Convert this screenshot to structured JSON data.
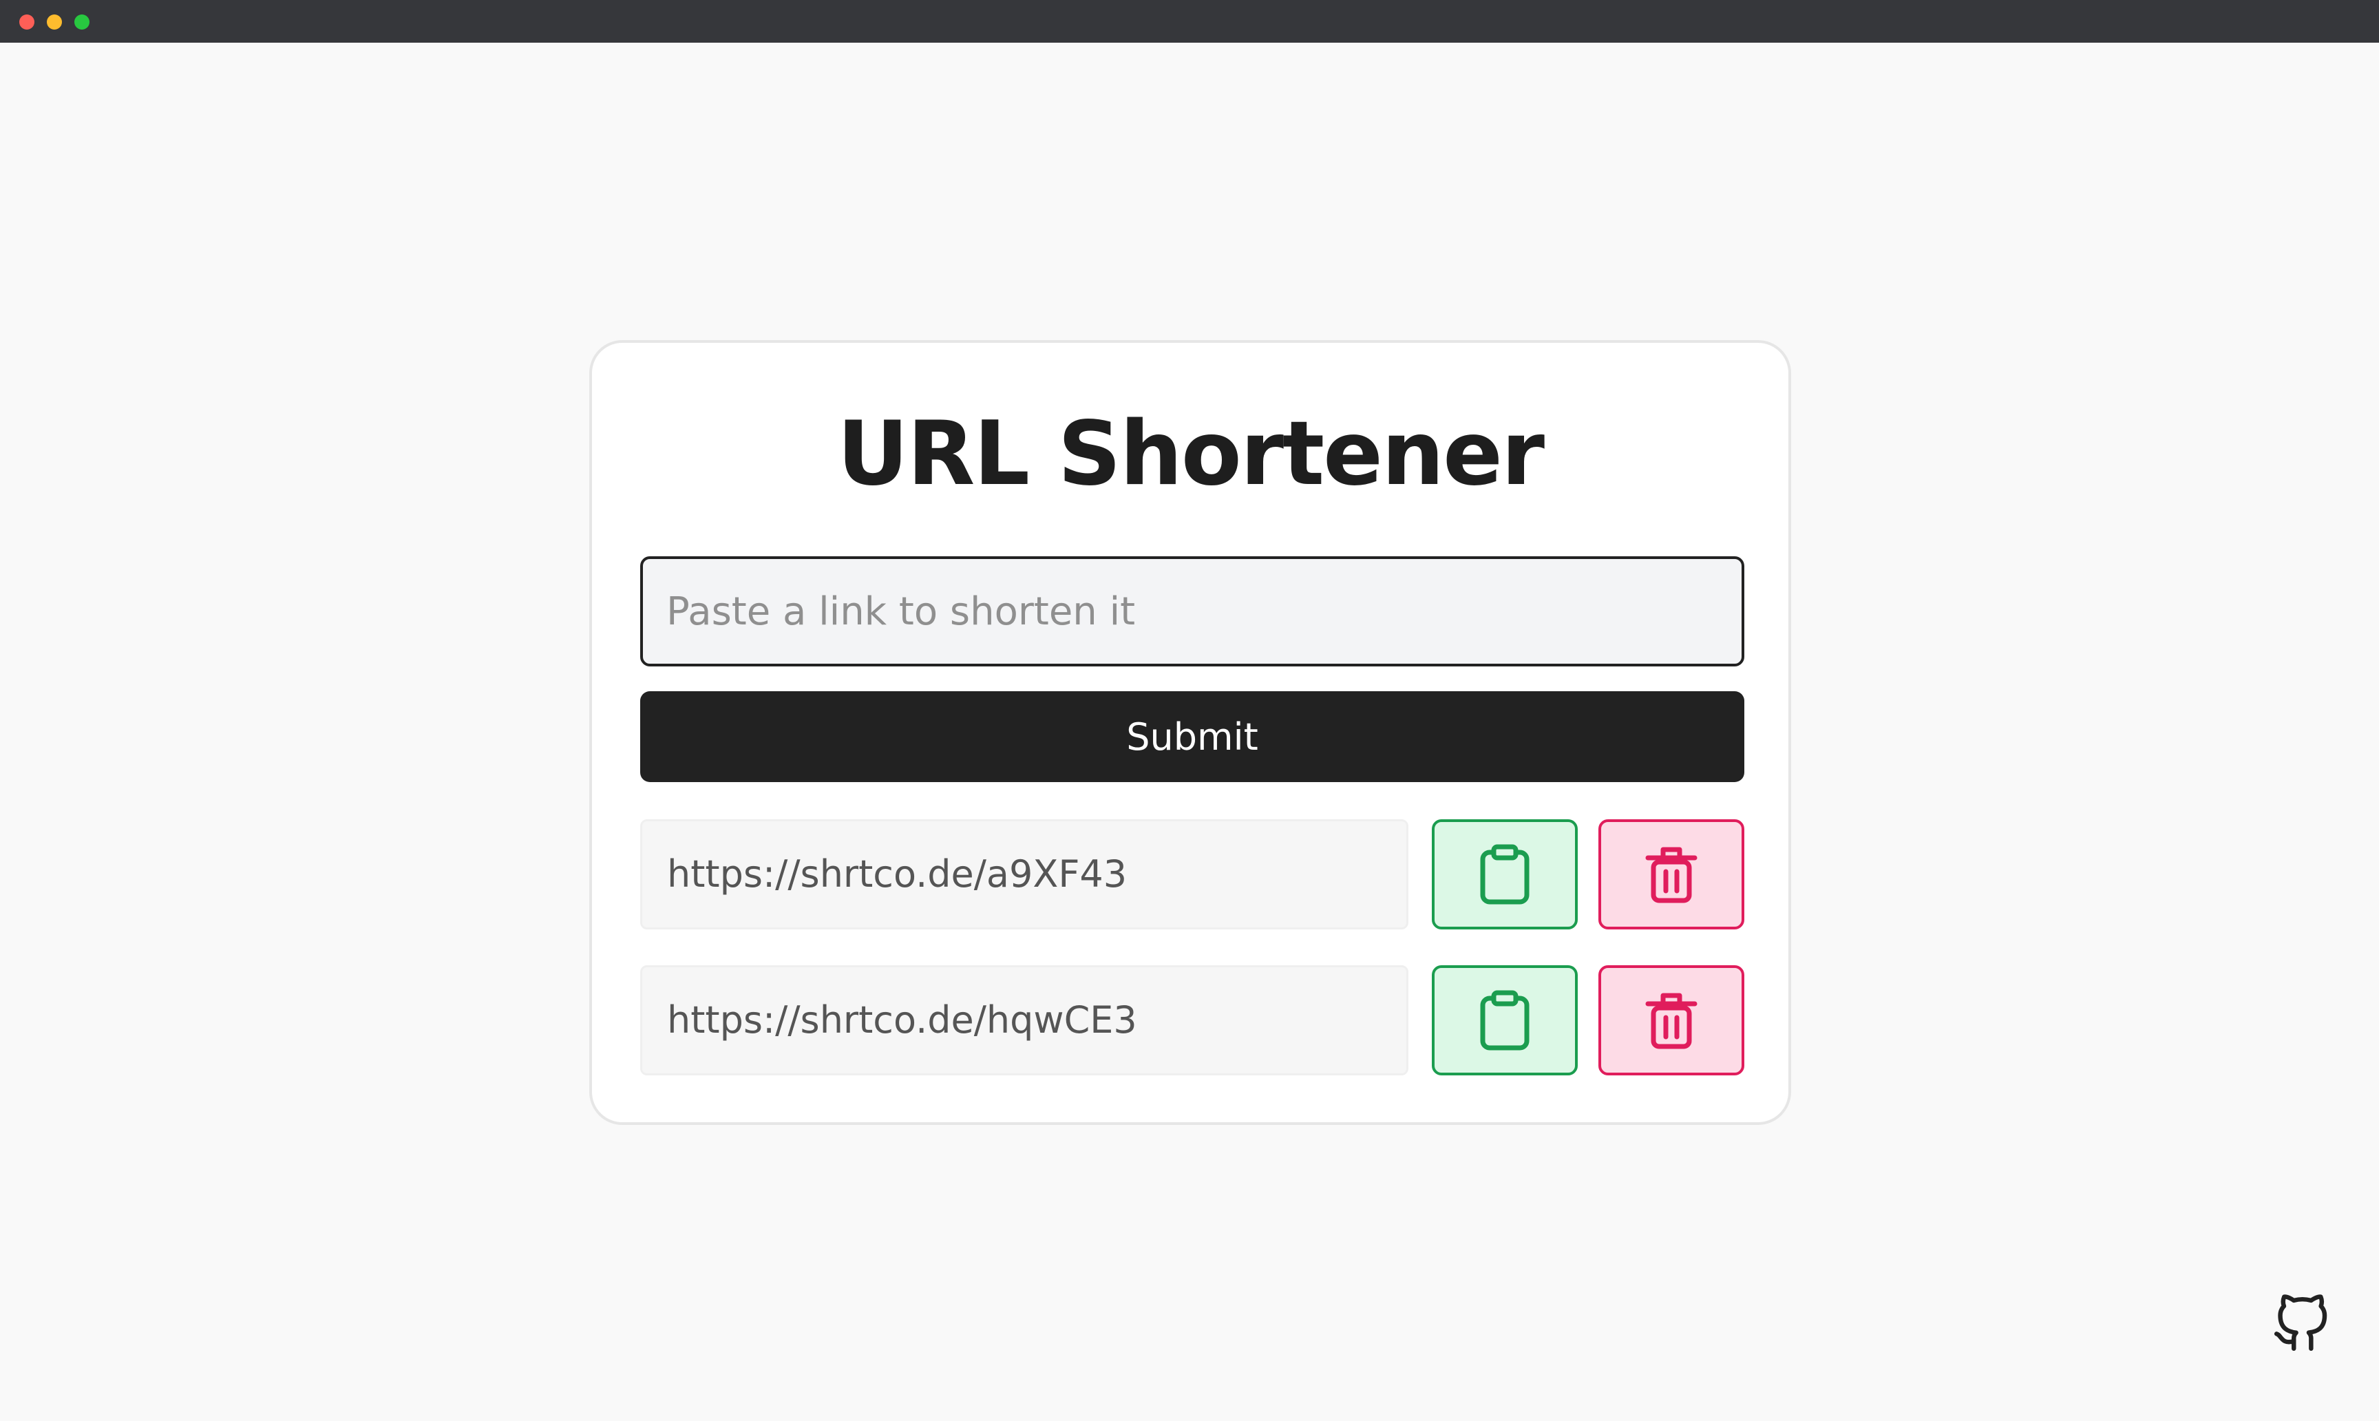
{
  "app": {
    "title": "URL Shortener"
  },
  "form": {
    "placeholder": "Paste a link to shorten it",
    "submit_label": "Submit"
  },
  "results": [
    {
      "url": "https://shrtco.de/a9XF43"
    },
    {
      "url": "https://shrtco.de/hqwCE3"
    }
  ],
  "icons": {
    "copy": "clipboard-icon",
    "delete": "trash-icon",
    "footer": "github-icon"
  },
  "colors": {
    "copy_accent": "#1b9d4f",
    "copy_bg": "#dcf8e6",
    "delete_accent": "#e01d5c",
    "delete_bg": "#fddbe6",
    "submit_bg": "#222222"
  }
}
